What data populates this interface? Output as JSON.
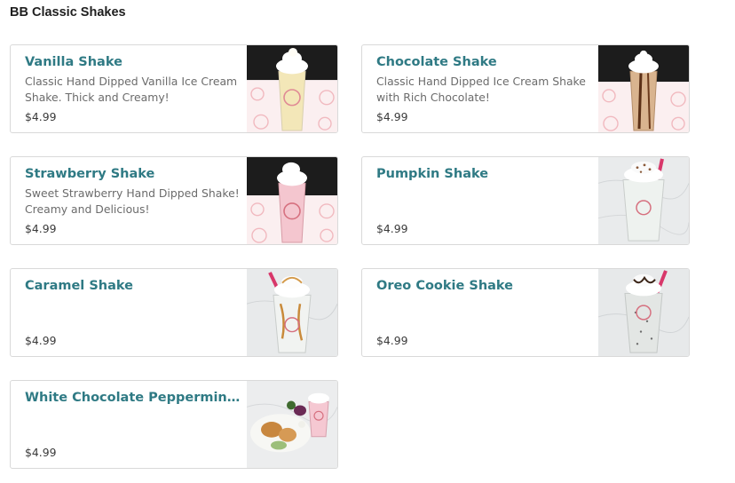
{
  "section": {
    "title": "BB Classic Shakes"
  },
  "items": [
    {
      "name": "Vanilla Shake",
      "description": "Classic Hand Dipped Vanilla Ice Cream Shake. Thick and Creamy!",
      "price": "$4.99",
      "photo": "vanilla-shake-photo",
      "drink_color": "#f3e7b8"
    },
    {
      "name": "Chocolate Shake",
      "description": "Classic Hand Dipped Ice Cream Shake with Rich Chocolate!",
      "price": "$4.99",
      "photo": "chocolate-shake-photo",
      "drink_color": "#d9b48f"
    },
    {
      "name": "Strawberry Shake",
      "description": "Sweet Strawberry Hand Dipped Shake! Creamy and Delicious!",
      "price": "$4.99",
      "photo": "strawberry-shake-photo",
      "drink_color": "#f4c6cf"
    },
    {
      "name": "Pumpkin Shake",
      "description": "",
      "price": "$4.99",
      "photo": "pumpkin-shake-photo",
      "drink_color": "#e9efe9"
    },
    {
      "name": "Caramel Shake",
      "description": "",
      "price": "$4.99",
      "photo": "caramel-shake-photo",
      "drink_color": "#eef0ee"
    },
    {
      "name": "Oreo Cookie Shake",
      "description": "",
      "price": "$4.99",
      "photo": "oreo-shake-photo",
      "drink_color": "#e3e6e4"
    },
    {
      "name": "White Chocolate Peppermint S...",
      "description": "",
      "price": "$4.99",
      "photo": "peppermint-shake-photo",
      "drink_color": "#f5c8d2"
    }
  ]
}
